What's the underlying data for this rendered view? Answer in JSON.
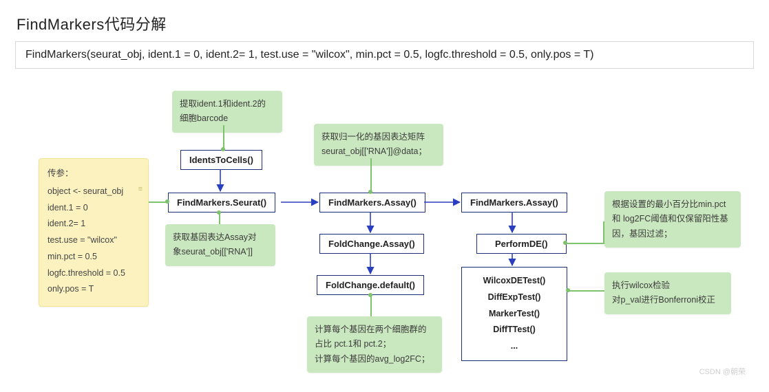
{
  "title": "FindMarkers代码分解",
  "code_line": "FindMarkers(seurat_obj, ident.1 = 0, ident.2= 1,  test.use = \"wilcox\", min.pct = 0.5, logfc.threshold = 0.5, only.pos = T)",
  "params_note": {
    "heading": "传参：",
    "lines": [
      "object <- seurat_obj",
      "ident.1 = 0",
      "ident.2= 1",
      "test.use = \"wilcox\"",
      "min.pct = 0.5",
      "logfc.threshold = 0.5",
      "only.pos = T"
    ]
  },
  "notes": {
    "barcode": "提取ident.1和ident.2的\n细胞barcode",
    "assay_obj": "获取基因表达Assay对\n象seurat_obj[['RNA']]",
    "norm_matrix": "获取归一化的基因表达矩阵\nseurat_obj[['RNA']]@data；",
    "foldchange_calc": "计算每个基因在两个细胞群的\n占比 pct.1和 pct.2；\n计算每个基因的avg_log2FC；",
    "filter": "根据设置的最小百分比min.pct\n和 log2FC阈值和仅保留阳性基\n因，基因过滤；",
    "wilcox": "执行wilcox检验\n对p_val进行Bonferroni校正"
  },
  "funcs": {
    "idents": "IdentsToCells()",
    "fm_seurat": "FindMarkers.Seurat()",
    "fm_assay1": "FindMarkers.Assay()",
    "fm_assay2": "FindMarkers.Assay()",
    "fc_assay": "FoldChange.Assay()",
    "fc_default": "FoldChange.default()",
    "performde": "PerformDE()",
    "tests": [
      "WilcoxDETest()",
      "DiffExpTest()",
      "MarkerTest()",
      "DiffTTest()",
      "..."
    ]
  },
  "watermark": "CSDN @朝荣"
}
